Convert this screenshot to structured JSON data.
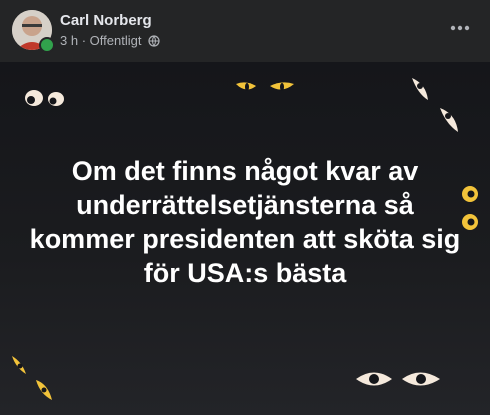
{
  "author": {
    "name": "Carl Norberg",
    "time": "3 h",
    "separator": "·",
    "audience": "Offentligt",
    "online": true
  },
  "post": {
    "text": "Om det finns något kvar av underrättelsetjänsterna så kommer presidenten att sköta sig för USA:s bästa",
    "background": "dark with cartoon eyes"
  },
  "icons": {
    "more": "more-options-icon",
    "audience": "globe-icon"
  },
  "colors": {
    "card_bg": "#242526",
    "text_primary": "#e4e6eb",
    "text_secondary": "#b0b3b8",
    "online": "#31a24c",
    "eye_white": "#f5e9dc",
    "eye_yellow": "#f2c33a"
  }
}
